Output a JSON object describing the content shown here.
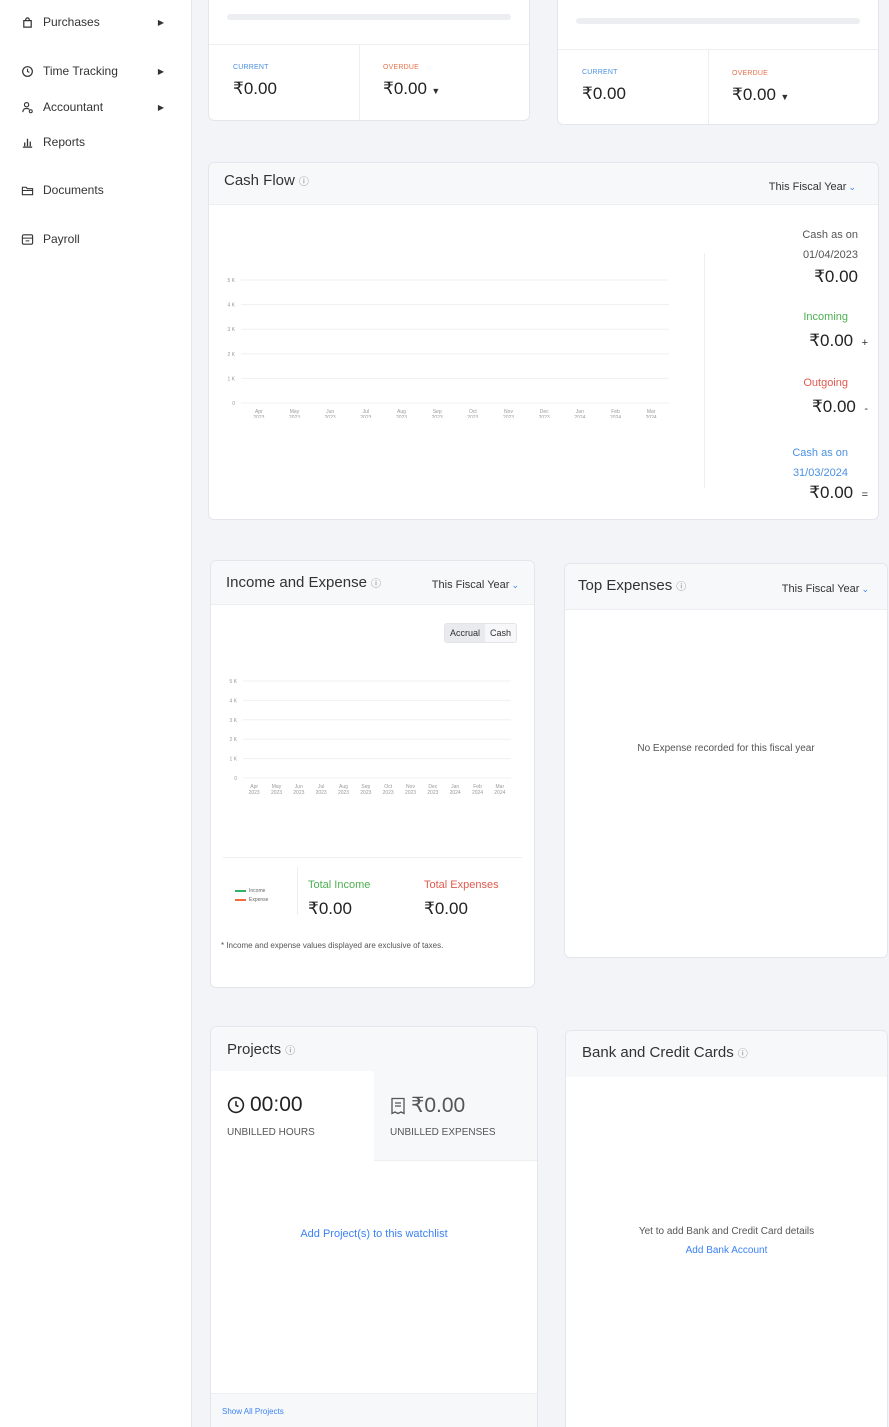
{
  "sidebar": {
    "items": [
      {
        "label": "Purchases",
        "icon": "bag-icon",
        "has_submenu": true
      },
      {
        "label": "Time Tracking",
        "icon": "clock-icon",
        "has_submenu": true
      },
      {
        "label": "Accountant",
        "icon": "accountant-icon",
        "has_submenu": true
      },
      {
        "label": "Reports",
        "icon": "bar-chart-icon",
        "has_submenu": false
      },
      {
        "label": "Documents",
        "icon": "folder-icon",
        "has_submenu": false
      },
      {
        "label": "Payroll",
        "icon": "payroll-icon",
        "has_submenu": false
      }
    ]
  },
  "receivables": {
    "current_label": "CURRENT",
    "current_value": "₹0.00",
    "overdue_label": "OVERDUE",
    "overdue_value": "₹0.00"
  },
  "payables": {
    "current_label": "CURRENT",
    "current_value": "₹0.00",
    "overdue_label": "OVERDUE",
    "overdue_value": "₹0.00"
  },
  "cash_flow": {
    "title": "Cash Flow",
    "period": "This Fiscal Year",
    "cash_start_label_1": "Cash as on",
    "cash_start_date": "01/04/2023",
    "cash_start_value": "₹0.00",
    "incoming_label": "Incoming",
    "incoming_value": "₹0.00",
    "incoming_sign": "+",
    "outgoing_label": "Outgoing",
    "outgoing_value": "₹0.00",
    "outgoing_sign": "-",
    "cash_end_label_1": "Cash as on",
    "cash_end_date": "31/03/2024",
    "cash_end_value": "₹0.00",
    "cash_end_sign": "="
  },
  "income_expense": {
    "title": "Income and Expense",
    "period": "This Fiscal Year",
    "toggle_accrual": "Accrual",
    "toggle_cash": "Cash",
    "legend_income": "Income",
    "legend_expense": "Expense",
    "total_income_label": "Total Income",
    "total_income_value": "₹0.00",
    "total_expenses_label": "Total Expenses",
    "total_expenses_value": "₹0.00",
    "footnote": "* Income and expense values displayed are exclusive of taxes."
  },
  "top_expenses": {
    "title": "Top Expenses",
    "period": "This Fiscal Year",
    "empty_message": "No Expense recorded for this fiscal year"
  },
  "projects": {
    "title": "Projects",
    "unbilled_hours_value": "00:00",
    "unbilled_hours_label": "UNBILLED HOURS",
    "unbilled_expenses_value": "₹0.00",
    "unbilled_expenses_label": "UNBILLED EXPENSES",
    "add_link": "Add Project(s) to this watchlist",
    "show_all": "Show All Projects"
  },
  "bank_cards": {
    "title": "Bank and Credit Cards",
    "empty_message": "Yet to add Bank and Credit Card details",
    "add_link": "Add Bank Account"
  },
  "chart_data": [
    {
      "type": "line",
      "title": "",
      "x": [
        "Apr 2023",
        "May 2023",
        "Jun 2023",
        "Jul 2023",
        "Aug 2023",
        "Sep 2023",
        "Oct 2023",
        "Nov 2023",
        "Dec 2023",
        "Jan 2024",
        "Feb 2024",
        "Mar 2024"
      ],
      "y_ticks": [
        "0",
        "1 K",
        "2 K",
        "3 K",
        "4 K",
        "5 K"
      ],
      "ylim": [
        0,
        5000
      ],
      "series": [],
      "grid": true
    },
    {
      "type": "bar",
      "title": "",
      "x": [
        "Apr 2023",
        "May 2023",
        "Jun 2023",
        "Jul 2023",
        "Aug 2023",
        "Sep 2023",
        "Oct 2023",
        "Nov 2023",
        "Dec 2023",
        "Jan 2024",
        "Feb 2024",
        "Mar 2024"
      ],
      "y_ticks": [
        "0",
        "1 K",
        "2 K",
        "3 K",
        "4 K",
        "5 K"
      ],
      "ylim": [
        0,
        5000
      ],
      "series": [
        {
          "name": "Income",
          "color": "#2fb36a",
          "values": [
            0,
            0,
            0,
            0,
            0,
            0,
            0,
            0,
            0,
            0,
            0,
            0
          ]
        },
        {
          "name": "Expense",
          "color": "#f06b3e",
          "values": [
            0,
            0,
            0,
            0,
            0,
            0,
            0,
            0,
            0,
            0,
            0,
            0
          ]
        }
      ],
      "grid": true
    }
  ]
}
